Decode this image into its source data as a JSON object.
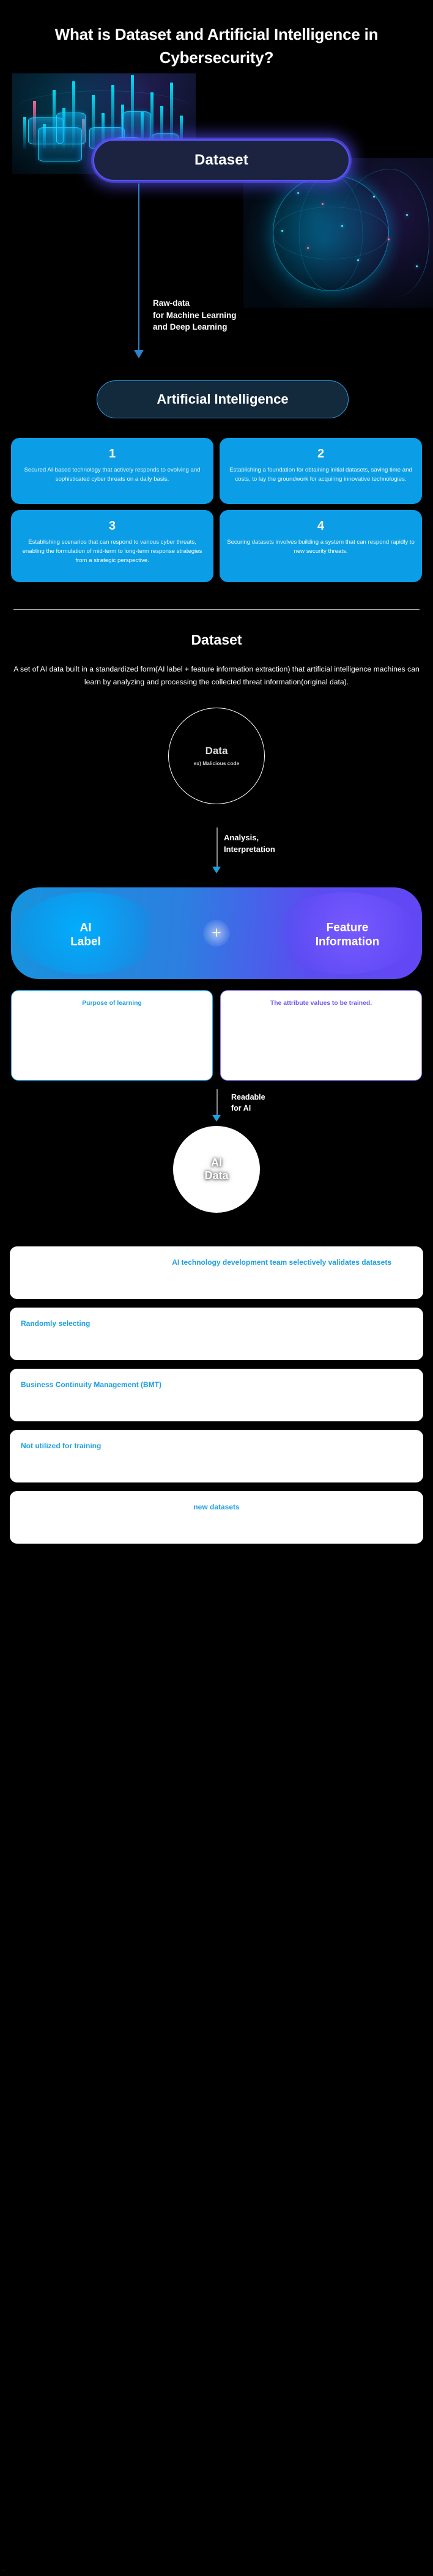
{
  "hero": {
    "title": "What is Dataset and Artificial Intelligence in Cybersecurity?",
    "dataset_pill": "Dataset",
    "flow_label": "Raw-data\nfor Machine Learning\nand Deep Learning",
    "ai_pill": "Artificial Intelligence"
  },
  "cards": [
    {
      "number": "1",
      "text": "Secured AI-based technology that actively responds to evolving and sophisticated cyber threats on a daily basis."
    },
    {
      "number": "2",
      "text": "Establishing a foundation for obtaining initial datasets, saving time and costs, to lay the groundwork for acquiring innovative technologies."
    },
    {
      "number": "3",
      "text": "Establishing scenarios that can respond to various cyber threats, enabling the formulation of mid-term to long-term response strategies from a strategic perspective."
    },
    {
      "number": "4",
      "text": "Securing datasets involves building a system that can respond rapidly to new security threats."
    }
  ],
  "dataset_section": {
    "title": "Dataset",
    "description": "A set of AI data built in a standardized form(AI label + feature information extraction) that artificial intelligence machines can learn by analyzing and processing the collected threat information(original data).",
    "data_circle": {
      "title": "Data",
      "example": "ex) Malicious code"
    },
    "analysis_label": "Analysis,\nInterpretation",
    "venn": {
      "left_label": "AI\nLabel",
      "plus": "+",
      "right_label": "Feature\nInformation"
    },
    "notes": [
      {
        "text": "Purpose of learning",
        "accent": "#1f9fe0"
      },
      {
        "text": "The attribute values to be trained.",
        "accent": "#6f5cf0"
      }
    ],
    "readable_label": "Readable\nfor AI",
    "ai_data_circle": "AI\nData"
  },
  "bottom_list": [
    {
      "text": "AI technology development team selectively validates datasets"
    },
    {
      "text": "Randomly selecting"
    },
    {
      "text": "Business Continuity Management (BMT)"
    },
    {
      "text": "Not utilized for training"
    },
    {
      "text": "new datasets"
    }
  ],
  "colors": {
    "background": "#000000",
    "card_blue": "#0b9ee6",
    "accent_blue": "#1f9fe0",
    "accent_purple": "#6f5cf0",
    "pill_border_purple": "#5b53ff",
    "pill_border_blue": "#2aa3e6"
  }
}
